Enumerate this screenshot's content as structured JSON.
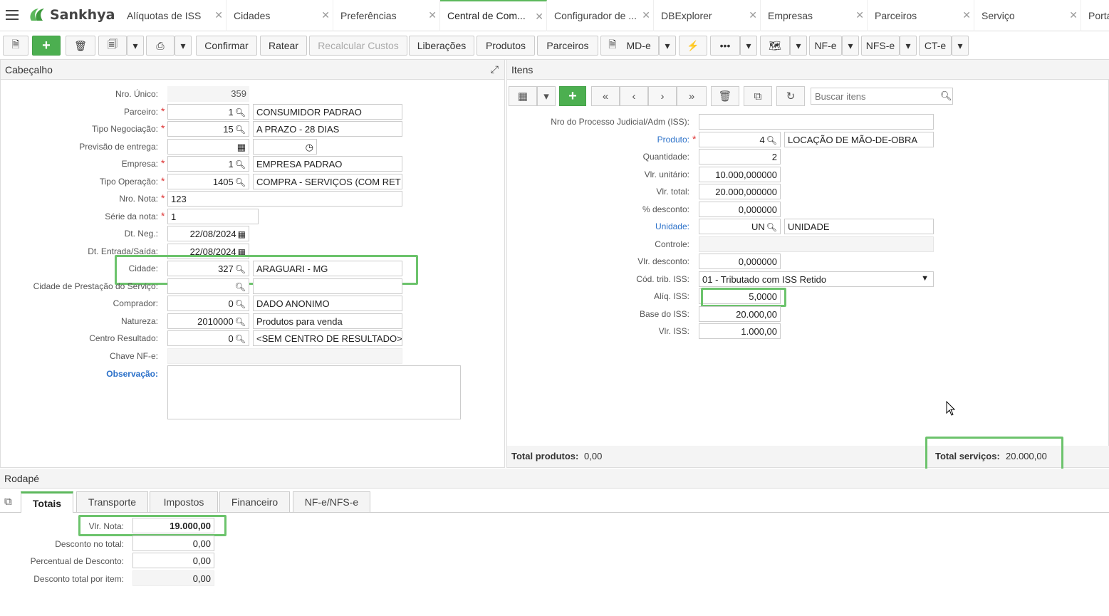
{
  "app": {
    "logo": "Sankhya"
  },
  "tabs": [
    {
      "label": "Alíquotas de ISS"
    },
    {
      "label": "Cidades"
    },
    {
      "label": "Preferências"
    },
    {
      "label": "Central de Com..."
    },
    {
      "label": "Configurador de ..."
    },
    {
      "label": "DBExplorer"
    },
    {
      "label": "Empresas"
    },
    {
      "label": "Parceiros"
    },
    {
      "label": "Serviço"
    },
    {
      "label": "Porta"
    }
  ],
  "toolbar": {
    "confirmar": "Confirmar",
    "ratear": "Ratear",
    "recalcular": "Recalcular Custos",
    "liberacoes": "Liberações",
    "produtos": "Produtos",
    "parceiros": "Parceiros",
    "mde": "MD-e",
    "nfe": "NF-e",
    "nfse": "NFS-e",
    "cte": "CT-e",
    "more": "•••"
  },
  "header_panel": {
    "title": "Cabeçalho",
    "labels": {
      "nro_unico": "Nro. Único:",
      "parceiro": "Parceiro:",
      "tipo_neg": "Tipo Negociação:",
      "previsao": "Previsão de entrega:",
      "empresa": "Empresa:",
      "tipo_op": "Tipo Operação:",
      "nro_nota": "Nro. Nota:",
      "serie": "Série da nota:",
      "dt_neg": "Dt. Neg.:",
      "dt_entrada": "Dt. Entrada/Saída:",
      "cidade": "Cidade:",
      "cidade_prest": "Cidade de Prestação do Serviço:",
      "comprador": "Comprador:",
      "natureza": "Natureza:",
      "centro": "Centro Resultado:",
      "chave": "Chave NF-e:",
      "obs": "Observação:"
    },
    "values": {
      "nro_unico": "359",
      "parceiro_cod": "1",
      "parceiro_nome": "CONSUMIDOR PADRAO",
      "tipo_neg_cod": "15",
      "tipo_neg_nome": "A PRAZO - 28 DIAS",
      "empresa_cod": "1",
      "empresa_nome": "EMPRESA PADRAO",
      "tipo_op_cod": "1405",
      "tipo_op_nome": "COMPRA - SERVIÇOS (COM RET",
      "nro_nota": "123",
      "serie": "1",
      "dt_neg": "22/08/2024",
      "dt_entrada": "22/08/2024",
      "cidade_cod": "327",
      "cidade_nome": "ARAGUARI - MG",
      "comprador_cod": "0",
      "comprador_nome": "DADO ANONIMO",
      "natureza_cod": "2010000",
      "natureza_nome": "Produtos para venda",
      "centro_cod": "0",
      "centro_nome": "<SEM CENTRO DE RESULTADO>"
    }
  },
  "items_panel": {
    "title": "Itens",
    "search_placeholder": "Buscar itens",
    "labels": {
      "processo": "Nro do Processo Judicial/Adm (ISS):",
      "produto": "Produto:",
      "quantidade": "Quantidade:",
      "vlr_unit": "Vlr. unitário:",
      "vlr_total": "Vlr. total:",
      "desconto_pct": "% desconto:",
      "unidade": "Unidade:",
      "controle": "Controle:",
      "vlr_desc": "Vlr. desconto:",
      "cod_trib": "Cód. trib. ISS:",
      "aliq": "Alíq. ISS:",
      "base": "Base do ISS:",
      "vlr_iss": "Vlr. ISS:"
    },
    "values": {
      "produto_cod": "4",
      "produto_nome": "LOCAÇÃO DE MÃO-DE-OBRA",
      "quantidade": "2",
      "vlr_unit": "10.000,000000",
      "vlr_total": "20.000,000000",
      "desconto_pct": "0,000000",
      "unidade_cod": "UN",
      "unidade_nome": "UNIDADE",
      "vlr_desc": "0,000000",
      "cod_trib": "01 - Tributado com ISS Retido",
      "aliq": "5,0000",
      "base": "20.000,00",
      "vlr_iss": "1.000,00"
    },
    "totals": {
      "produtos_label": "Total produtos:",
      "produtos_value": "0,00",
      "servicos_label": "Total serviços:",
      "servicos_value": "20.000,00"
    }
  },
  "footer_panel": {
    "title": "Rodapé",
    "tabs": [
      "Totais",
      "Transporte",
      "Impostos",
      "Financeiro",
      "NF-e/NFS-e"
    ],
    "labels": {
      "vlr_nota": "Vlr. Nota:",
      "desc_total": "Desconto no total:",
      "perc_desc": "Percentual de Desconto:",
      "desc_item": "Desconto total por item:"
    },
    "values": {
      "vlr_nota": "19.000,00",
      "desc_total": "0,00",
      "perc_desc": "0,00",
      "desc_item": "0,00"
    }
  },
  "colors": {
    "accent": "#4caf50",
    "highlight": "#6cc36c",
    "link": "#2a70c9",
    "required": "#dd3333"
  }
}
